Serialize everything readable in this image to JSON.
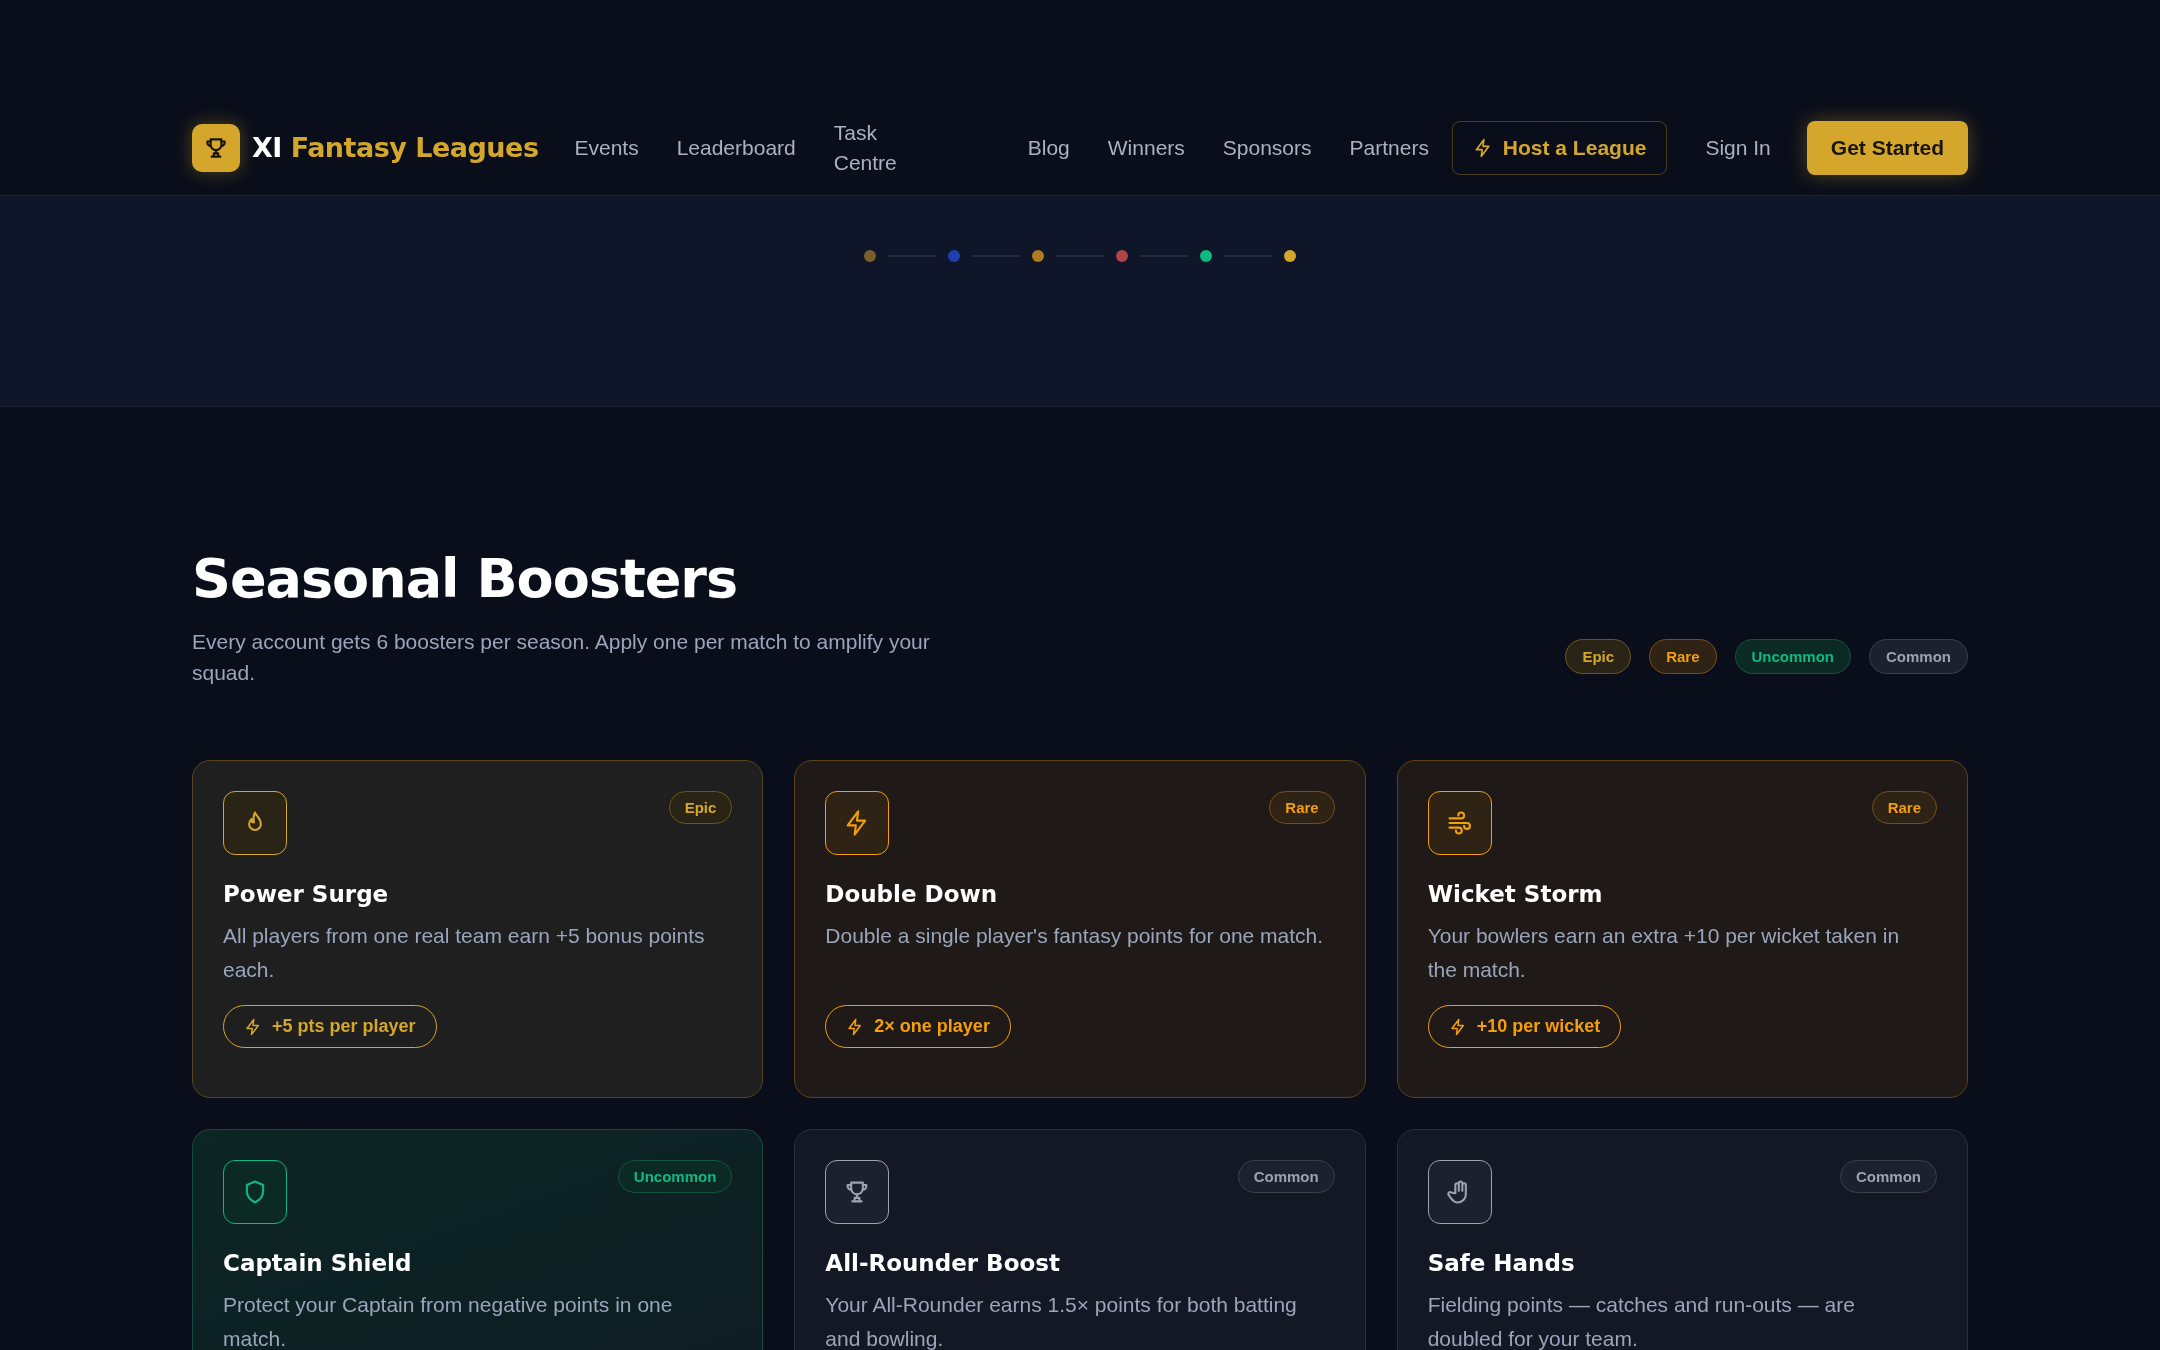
{
  "header": {
    "logo": {
      "prefix": "XI",
      "name": "Fantasy Leagues"
    },
    "nav": [
      {
        "label": "Events"
      },
      {
        "label": "Leaderboard"
      },
      {
        "label": "Task Centre"
      },
      {
        "label": "Blog"
      },
      {
        "label": "Winners"
      },
      {
        "label": "Sponsors"
      },
      {
        "label": "Partners"
      }
    ],
    "host_button": "Host a League",
    "sign_in": "Sign In",
    "cta": "Get Started"
  },
  "progress_dots": [
    {
      "color": "#7a5f2a"
    },
    {
      "color": "#1e40af"
    },
    {
      "color": "#b07a20"
    },
    {
      "color": "#b04545"
    },
    {
      "color": "#10b981"
    },
    {
      "color": "#d4a72c"
    }
  ],
  "section": {
    "title": "Seasonal Boosters",
    "subtitle": "Every account gets 6 boosters per season. Apply one per match to amplify your squad.",
    "legend": [
      {
        "label": "Epic",
        "kind": "epic"
      },
      {
        "label": "Rare",
        "kind": "rare"
      },
      {
        "label": "Uncommon",
        "kind": "uncommon"
      },
      {
        "label": "Common",
        "kind": "common"
      }
    ]
  },
  "boosters": [
    {
      "title": "Power Surge",
      "badge": "Epic",
      "kind": "epic",
      "description": "All players from one real team earn +5 bonus points each.",
      "effect": "+5 pts per player"
    },
    {
      "title": "Double Down",
      "badge": "Rare",
      "kind": "rare",
      "description": "Double a single player's fantasy points for one match.",
      "effect": "2× one player"
    },
    {
      "title": "Wicket Storm",
      "badge": "Rare",
      "kind": "rare",
      "description": "Your bowlers earn an extra +10 per wicket taken in the match.",
      "effect": "+10 per wicket"
    },
    {
      "title": "Captain Shield",
      "badge": "Uncommon",
      "kind": "uncommon",
      "description": "Protect your Captain from negative points in one match."
    },
    {
      "title": "All-Rounder Boost",
      "badge": "Common",
      "kind": "common",
      "description": "Your All-Rounder earns 1.5× points for both batting and bowling."
    },
    {
      "title": "Safe Hands",
      "badge": "Common",
      "kind": "common",
      "description": "Fielding points — catches and run-outs — are doubled for your team."
    }
  ]
}
